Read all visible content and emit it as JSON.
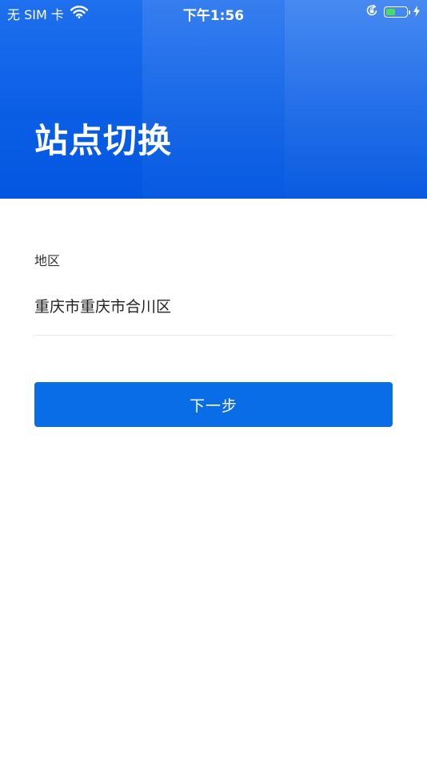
{
  "status_bar": {
    "carrier": "无 SIM 卡",
    "time": "下午1:56",
    "battery_level": 0.45,
    "battery_color": "#4cd964"
  },
  "header": {
    "title": "站点切换",
    "background_color": "#0b5fe6"
  },
  "form": {
    "region_label": "地区",
    "region_value": "重庆市重庆市合川区"
  },
  "actions": {
    "next_label": "下一步",
    "button_color": "#0a6de8"
  },
  "icons": [
    "wifi-icon",
    "rotation-lock-icon",
    "battery-icon",
    "charging-bolt-icon"
  ]
}
